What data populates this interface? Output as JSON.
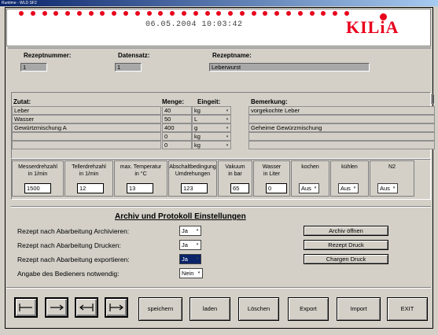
{
  "window_title": "Runtime - WLD SF2",
  "header": {
    "datetime": "06.05.2004 10:03:42",
    "logo": "KILiA"
  },
  "recipe": {
    "nummer_label": "Rezeptnummer:",
    "nummer_value": "1",
    "datensatz_label": "Datensatz:",
    "datensatz_value": "1",
    "name_label": "Rezeptname:",
    "name_value": "Leberwurst"
  },
  "ingredients": {
    "headers": {
      "zutat": "Zutat:",
      "menge": "Menge:",
      "einheit": "Eingeit:",
      "bemerkung": "Bemerkung:"
    },
    "rows": [
      {
        "zutat": "Leber",
        "menge": "40",
        "einheit": "kg",
        "bemerkung": "vorgekochte Leber"
      },
      {
        "zutat": "Wasser",
        "menge": "50",
        "einheit": "L",
        "bemerkung": ""
      },
      {
        "zutat": "Gewürtzmischung A",
        "menge": "400",
        "einheit": "g",
        "bemerkung": "Geheime Gewürzmischung"
      },
      {
        "zutat": "",
        "menge": "0",
        "einheit": "kg",
        "bemerkung": ""
      },
      {
        "zutat": "",
        "menge": "0",
        "einheit": "kg",
        "bemerkung": ""
      }
    ]
  },
  "params": [
    {
      "label1": "Messerdrehzahl",
      "label2": "in 1/min",
      "value": "1500"
    },
    {
      "label1": "Tellerdrehzahl",
      "label2": "in 1/min",
      "value": "12"
    },
    {
      "label1": "max. Temperatur",
      "label2": "in °C",
      "value": "13"
    },
    {
      "label1": "Abschaltbedingung",
      "label2": "Umdrehungen",
      "value": "123"
    },
    {
      "label1": "Vakuum",
      "label2": "in bar",
      "value": "65"
    },
    {
      "label1": "Wasser",
      "label2": "in Liter",
      "value": "0"
    },
    {
      "label1": "kochen",
      "label2": "",
      "value": "Aus"
    },
    {
      "label1": "kühlen",
      "label2": "",
      "value": "Aus"
    },
    {
      "label1": "N2",
      "label2": "",
      "value": "Aus"
    }
  ],
  "settings": {
    "title": "Archiv und Protokoll Einstellungen",
    "rows": [
      {
        "label": "Rezept nach Abarbeitung Archivieren:",
        "value": "Ja"
      },
      {
        "label": "Rezept nach Abarbeitung Drucken:",
        "value": "Ja"
      },
      {
        "label": "Rezept nach Abarbeitung exportieren:",
        "value": "Ja"
      },
      {
        "label": "Angabe des Bedieners notwendig:",
        "value": "Nein"
      }
    ],
    "buttons": {
      "archiv": "Archiv öffnen",
      "rezept_druck": "Rezept Druck",
      "chargen_druck": "Chargen Druck"
    }
  },
  "toolbar": {
    "speichern": "speichern",
    "laden": "laden",
    "loeschen": "Löschen",
    "export": "Export",
    "import": "Import",
    "exit": "EXIT"
  },
  "colors": {
    "accent": "#e8001c",
    "panel": "#d4d0c8",
    "selection": "#0a246a"
  }
}
